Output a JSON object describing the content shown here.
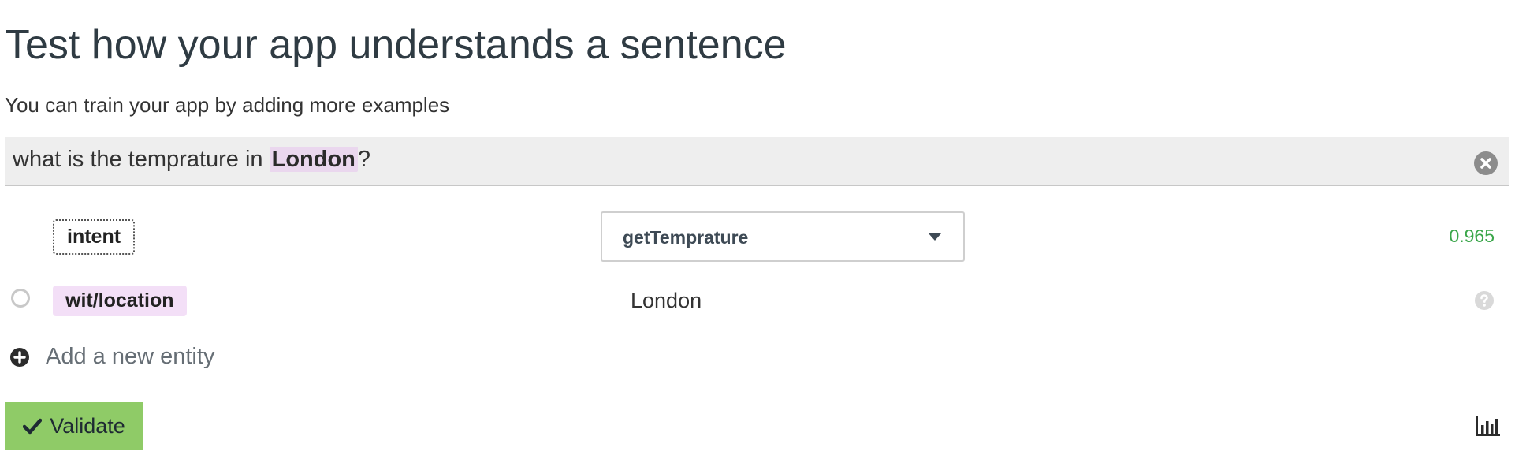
{
  "header": {
    "title": "Test how your app understands a sentence",
    "subtitle": "You can train your app by adding more examples"
  },
  "sentence": {
    "before": "what is the temprature in ",
    "highlight": "London",
    "after": "?"
  },
  "intent": {
    "tag": "intent",
    "selected": "getTemprature",
    "confidence": "0.965"
  },
  "entity": {
    "tag": "wit/location",
    "value": "London"
  },
  "actions": {
    "add_entity": "Add a new entity",
    "validate": "Validate"
  },
  "colors": {
    "validate_bg": "#8fcb67",
    "entity_highlight": "#f3dff7",
    "confidence": "#3aa64a"
  },
  "icons": [
    "clear-icon",
    "chevron-down-icon",
    "help-icon",
    "plus-circle-icon",
    "check-icon",
    "bar-chart-icon"
  ]
}
